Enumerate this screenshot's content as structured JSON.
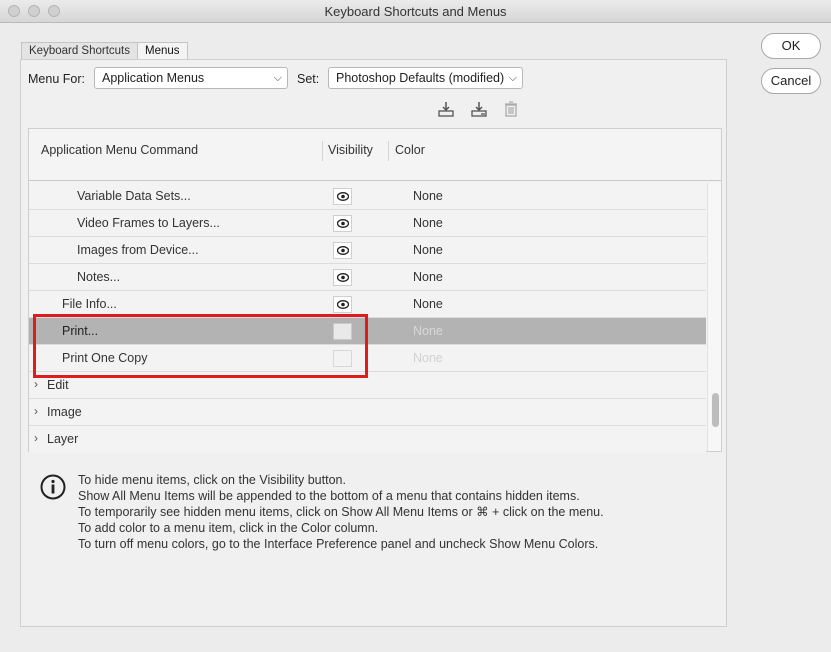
{
  "window": {
    "title": "Keyboard Shortcuts and Menus"
  },
  "tabs": [
    {
      "label": "Keyboard Shortcuts",
      "active": false
    },
    {
      "label": "Menus",
      "active": true
    }
  ],
  "menu_for": {
    "label": "Menu For:",
    "value": "Application Menus"
  },
  "set": {
    "label": "Set:",
    "value": "Photoshop Defaults (modified)"
  },
  "toolbar": {
    "icons": [
      "save-set-icon",
      "save-set-as-icon",
      "delete-set-icon"
    ]
  },
  "table": {
    "headers": {
      "command": "Application Menu Command",
      "visibility": "Visibility",
      "color": "Color"
    },
    "rows": [
      {
        "name": "Variable Data Sets...",
        "indent": 2,
        "visible": true,
        "color": "None",
        "state": "normal"
      },
      {
        "name": "Video Frames to Layers...",
        "indent": 2,
        "visible": true,
        "color": "None",
        "state": "normal"
      },
      {
        "name": "Images from Device...",
        "indent": 2,
        "visible": true,
        "color": "None",
        "state": "normal"
      },
      {
        "name": "Notes...",
        "indent": 2,
        "visible": true,
        "color": "None",
        "state": "normal"
      },
      {
        "name": "File Info...",
        "indent": 1,
        "visible": true,
        "color": "None",
        "state": "normal"
      },
      {
        "name": "Print...",
        "indent": 1,
        "visible": false,
        "color": "None",
        "state": "selected"
      },
      {
        "name": "Print One Copy",
        "indent": 1,
        "visible": false,
        "color": "None",
        "state": "dim"
      },
      {
        "name": "Edit",
        "indent": 0,
        "group": true
      },
      {
        "name": "Image",
        "indent": 0,
        "group": true
      },
      {
        "name": "Layer",
        "indent": 0,
        "group": true
      }
    ]
  },
  "info": {
    "lines": [
      "To hide menu items, click on the Visibility button.",
      "Show All Menu Items will be appended to the bottom of a menu that contains hidden items.",
      "To temporarily see hidden menu items, click on Show All Menu Items or ⌘ + click on the menu.",
      "To add color to a menu item, click in the Color column.",
      "To turn off menu colors, go to the Interface Preference panel and uncheck Show Menu Colors."
    ]
  },
  "buttons": {
    "ok": "OK",
    "cancel": "Cancel"
  },
  "colors": {
    "highlight": "#e01b1b",
    "selected_row": "#b3b3b3"
  }
}
